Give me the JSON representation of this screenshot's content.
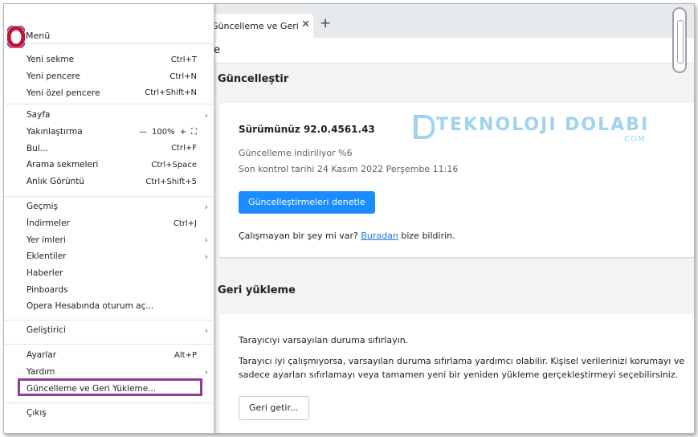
{
  "tab": {
    "title": "Güncelleme ve Geri Yükleme",
    "close": "✕",
    "new": "+"
  },
  "pagebar": {
    "title_fragment": "te"
  },
  "update_section": {
    "title": "Güncelleştir",
    "version": "Sürümünüz  92.0.4561.43",
    "status1": "Güncelleme indiriliyor %6",
    "status2": "Son kontrol tarihi 24 Kasım 2022 Perşembe 11:16",
    "button": "Güncelleştirmeleri denetle",
    "help_prefix": "Çalışmayan bir şey mi var? ",
    "help_link": "Buradan",
    "help_suffix": " bize bildirin."
  },
  "reset_section": {
    "title": "Geri yükleme",
    "p1": "Tarayıcıyı varsayılan duruma sıfırlayın.",
    "p2": "Tarayıcı iyi çalışmıyorsa, varsayılan duruma sıfırlama yardımcı olabilir. Kişisel verilerinizi korumayı ve sadece ayarları sıfırlamayı veya tamamen yeni bir yeniden yükleme gerçekleştirmeyi seçebilirsiniz.",
    "button": "Geri getir..."
  },
  "watermark": {
    "text": "TEKNOLOJI DOLABI",
    "suffix": ".COM"
  },
  "menu": {
    "label": "Menü",
    "logo": "opera-o-icon",
    "groups": [
      [
        {
          "label": "Yeni sekme",
          "shortcut": "Ctrl+T"
        },
        {
          "label": "Yeni pencere",
          "shortcut": "Ctrl+N"
        },
        {
          "label": "Yeni özel pencere",
          "shortcut": "Ctrl+Shift+N"
        }
      ],
      [
        {
          "label": "Sayfa",
          "arrow": "›"
        },
        {
          "label": "Yakınlaştırma",
          "zoom": {
            "minus": "—",
            "value": "100%",
            "plus": "+",
            "full": "⛶"
          }
        },
        {
          "label": "Bul...",
          "shortcut": "Ctrl+F"
        },
        {
          "label": "Arama sekmeleri",
          "shortcut": "Ctrl+Space"
        },
        {
          "label": "Anlık Görüntü",
          "shortcut": "Ctrl+Shift+5"
        }
      ],
      [
        {
          "label": "Geçmiş",
          "arrow": "›"
        },
        {
          "label": "İndirmeler",
          "shortcut": "Ctrl+J"
        },
        {
          "label": "Yer imleri",
          "arrow": "›"
        },
        {
          "label": "Eklentiler",
          "arrow": "›"
        },
        {
          "label": "Haberler"
        },
        {
          "label": "Pinboards"
        },
        {
          "label": "Opera Hesabında oturum aç..."
        }
      ],
      [
        {
          "label": "Geliştirici",
          "arrow": "›"
        }
      ],
      [
        {
          "label": "Ayarlar",
          "shortcut": "Alt+P"
        },
        {
          "label": "Yardım",
          "arrow": "›"
        },
        {
          "label": "Güncelleme ve Geri Yükleme..."
        }
      ],
      [
        {
          "label": "Çıkış"
        }
      ]
    ],
    "highlight_color": "#8e3d95"
  }
}
